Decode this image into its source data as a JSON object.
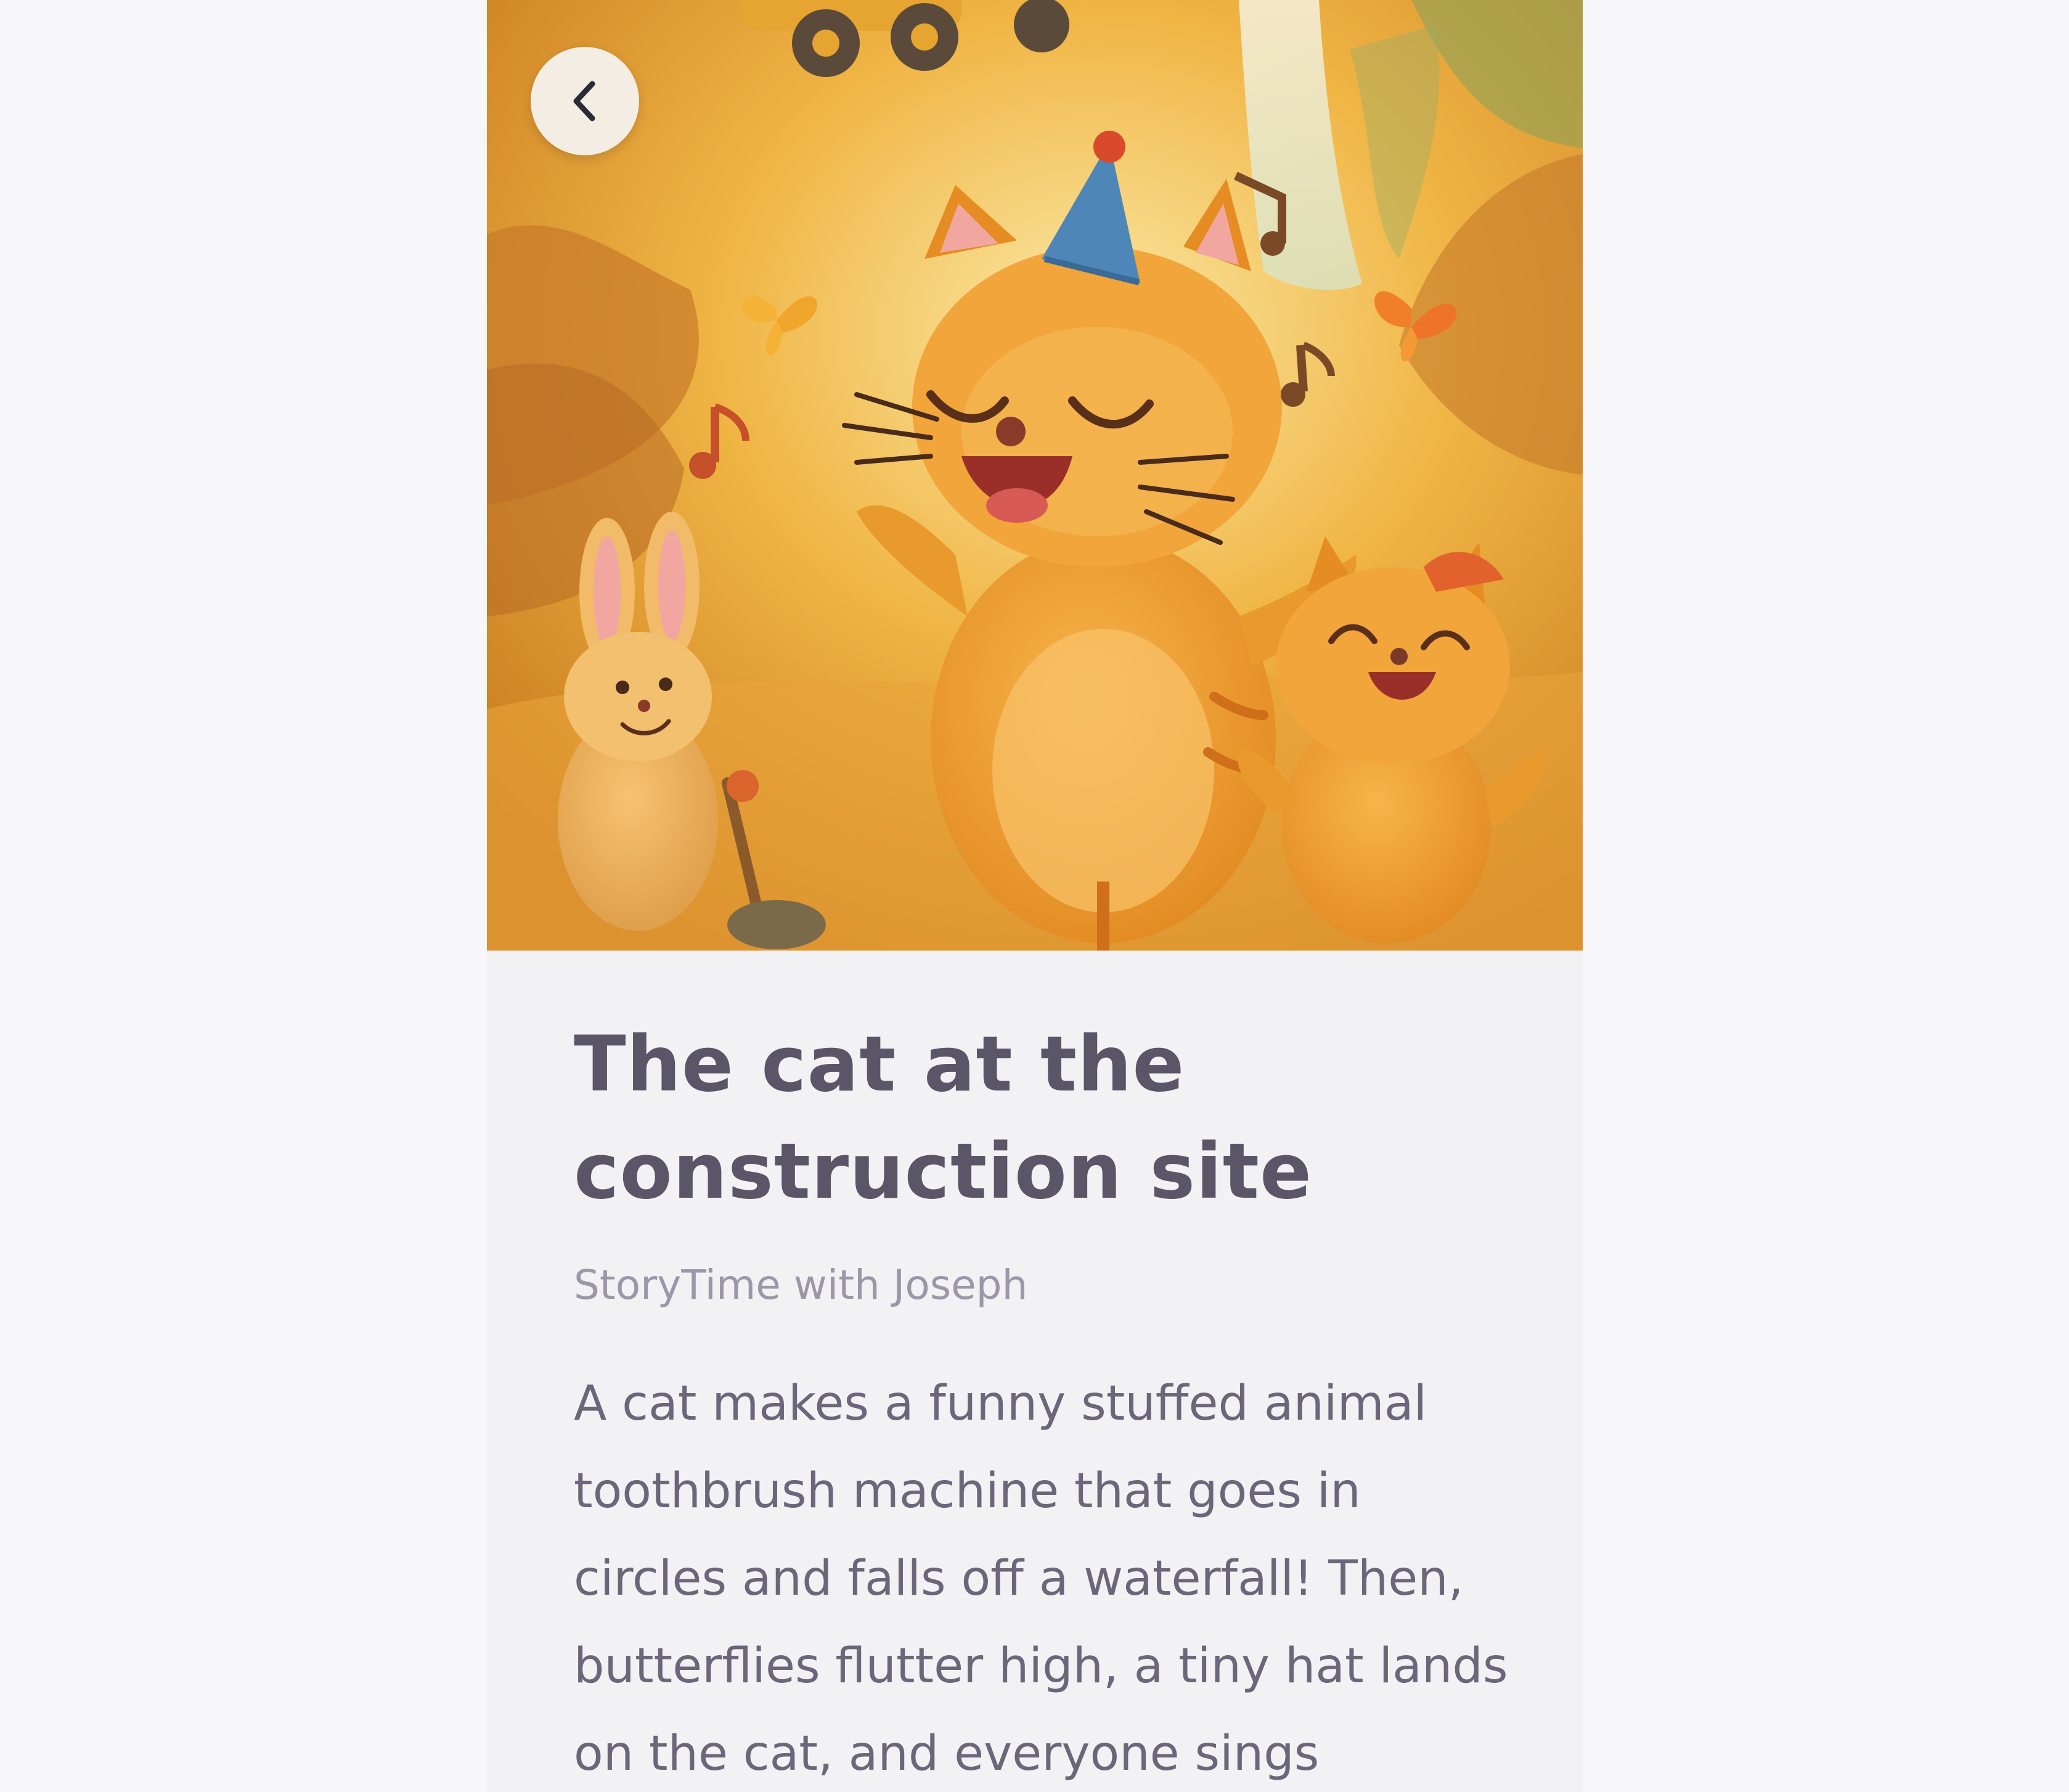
{
  "navigation": {
    "back_icon": "chevron-left-icon"
  },
  "story": {
    "title": "The cat at the construction site",
    "author": "StoryTime with Joseph",
    "description": "A cat makes a funny stuffed animal toothbrush machine that goes in circles and falls off a waterfall! Then, butterflies flutter high, a tiny hat lands on the cat, and everyone sings"
  },
  "colors": {
    "background": "#f7f7f9",
    "card": "#f2f2f4",
    "title_text": "#5a5668",
    "author_text": "#9c97a8",
    "body_text": "#6b6679",
    "illustration_main": "#e89a2c"
  }
}
